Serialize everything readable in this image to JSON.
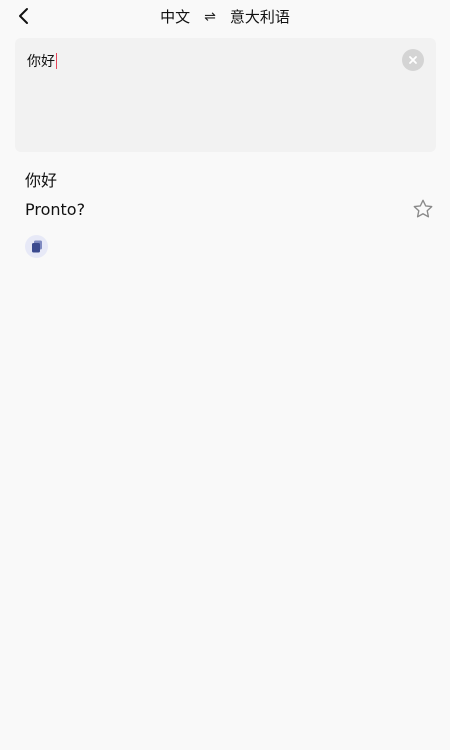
{
  "header": {
    "source_lang": "中文",
    "swap_symbol": "⇌",
    "target_lang": "意大利语"
  },
  "input": {
    "value": "你好"
  },
  "result": {
    "source": "你好",
    "translation": "Pronto?"
  },
  "icons": {
    "back": "chevron-left-icon",
    "clear": "close-circle-icon",
    "favorite": "star-outline-icon",
    "copy": "copy-icon"
  },
  "colors": {
    "background": "#f9f9f9",
    "input_bg": "#f2f2f2",
    "caret": "#e6455a",
    "copy_accent": "#3b4a8f",
    "copy_bg": "#e7e9f7"
  }
}
